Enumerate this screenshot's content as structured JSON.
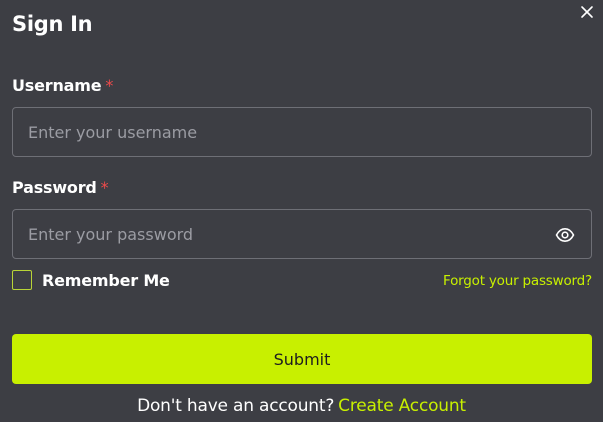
{
  "dialog": {
    "title": "Sign In",
    "close_icon": "close-icon"
  },
  "username": {
    "label": "Username",
    "required_mark": "*",
    "placeholder": "Enter your username",
    "value": ""
  },
  "password": {
    "label": "Password",
    "required_mark": "*",
    "placeholder": "Enter your password",
    "value": "",
    "toggle_icon": "eye-icon"
  },
  "remember": {
    "label": "Remember Me",
    "checked": false
  },
  "forgot": {
    "label": "Forgot your password?"
  },
  "submit": {
    "label": "Submit"
  },
  "signup": {
    "prompt": "Don't have an account?",
    "link": "Create Account"
  },
  "colors": {
    "background": "#3d3e44",
    "accent": "#c8f000",
    "required": "#ef4b4b",
    "border": "#6e6f76"
  }
}
